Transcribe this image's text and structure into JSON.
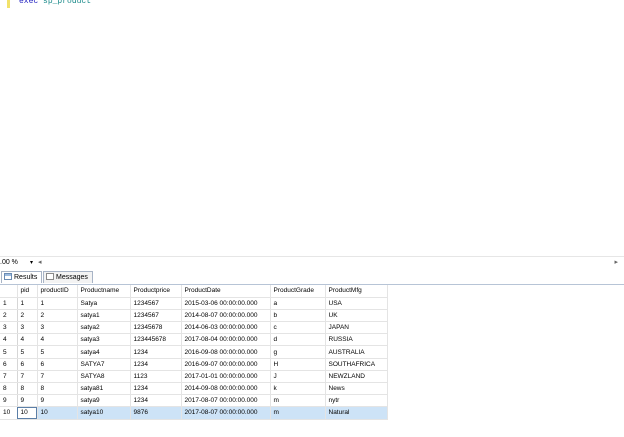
{
  "editor": {
    "keyword": "exec",
    "procedure": "sp_product"
  },
  "statusbar": {
    "zoom": ".00 %",
    "zoom_arrow": "▾",
    "scroll_left": "◂",
    "scroll_right": "▸"
  },
  "tabs": [
    {
      "label": "Results",
      "icon": "grid-icon"
    },
    {
      "label": "Messages",
      "icon": "messages-icon"
    }
  ],
  "results": {
    "columns": [
      "",
      "pid",
      "productID",
      "Productname",
      "Productprice",
      "ProductDate",
      "ProductGrade",
      "ProductMfg"
    ],
    "rows": [
      [
        "1",
        "1",
        "1",
        "Satya",
        "1234567",
        "2015-03-06 00:00:00.000",
        "a",
        "USA"
      ],
      [
        "2",
        "2",
        "2",
        "satya1",
        "1234567",
        "2014-08-07 00:00:00.000",
        "b",
        "UK"
      ],
      [
        "3",
        "3",
        "3",
        "satya2",
        "12345678",
        "2014-06-03 00:00:00.000",
        "c",
        "JAPAN"
      ],
      [
        "4",
        "4",
        "4",
        "satya3",
        "123445678",
        "2017-08-04 00:00:00.000",
        "d",
        "RUSSIA"
      ],
      [
        "5",
        "5",
        "5",
        "satya4",
        "1234",
        "2016-09-08 00:00:00.000",
        "g",
        "AUSTRALIA"
      ],
      [
        "6",
        "6",
        "6",
        "SATYA7",
        "1234",
        "2016-09-07 00:00:00.000",
        "H",
        "SOUTHAFRICA"
      ],
      [
        "7",
        "7",
        "7",
        "SATYA8",
        "1123",
        "2017-01-01 00:00:00.000",
        "J",
        "NEWZLAND"
      ],
      [
        "8",
        "8",
        "8",
        "satya81",
        "1234",
        "2014-09-08 00:00:00.000",
        "k",
        "News"
      ],
      [
        "9",
        "9",
        "9",
        "satya9",
        "1234",
        "2017-08-07 00:00:00.000",
        "m",
        "nytr"
      ],
      [
        "10",
        "10",
        "10",
        "satya10",
        "9876",
        "2017-08-07 00:00:00.000",
        "m",
        "Natural"
      ]
    ],
    "selected_row": 9
  },
  "colors": {
    "keyword": "#2020c0",
    "identifier": "#1a8a8a",
    "selection": "#cde3f7"
  }
}
